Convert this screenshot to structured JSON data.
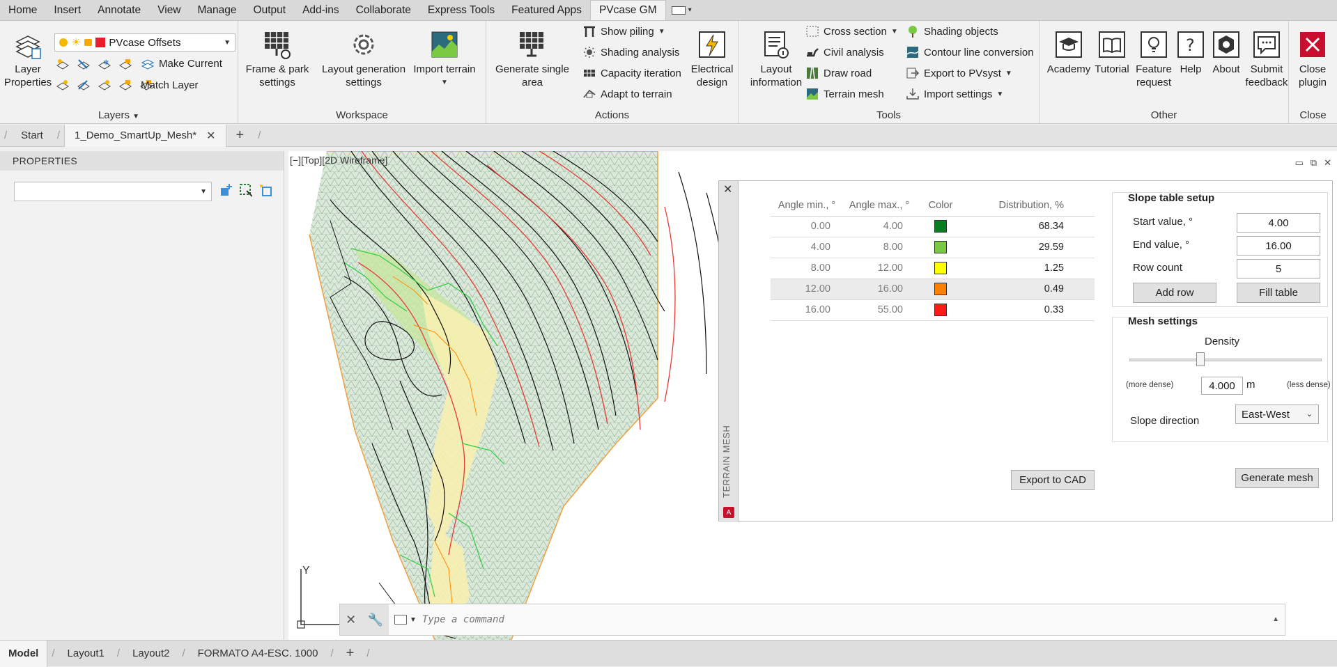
{
  "ribbon_tabs": [
    "Home",
    "Insert",
    "Annotate",
    "View",
    "Manage",
    "Output",
    "Add-ins",
    "Collaborate",
    "Express Tools",
    "Featured Apps",
    "PVcase GM"
  ],
  "active_tab": "PVcase GM",
  "layers_panel": {
    "layer_properties_l1": "Layer",
    "layer_properties_l2": "Properties",
    "layer_dropdown": "PVcase Offsets",
    "make_current": "Make Current",
    "match_layer": "Match Layer",
    "label": "Layers"
  },
  "workspace_panel": {
    "frame_park_l1": "Frame & park",
    "frame_park_l2": "settings",
    "layout_gen_l1": "Layout generation",
    "layout_gen_l2": "settings",
    "import_terrain": "Import terrain",
    "label": "Workspace"
  },
  "actions_panel": {
    "generate_l1": "Generate single",
    "generate_l2": "area",
    "show_piling": "Show piling",
    "shading_analysis": "Shading analysis",
    "capacity_iteration": "Capacity iteration",
    "adapt_to_terrain": "Adapt to terrain",
    "electrical_l1": "Electrical",
    "electrical_l2": "design",
    "label": "Actions"
  },
  "tools_panel": {
    "layout_info_l1": "Layout",
    "layout_info_l2": "information",
    "cross_section": "Cross section",
    "civil_analysis": "Civil analysis",
    "draw_road": "Draw road",
    "terrain_mesh": "Terrain mesh",
    "shading_objects": "Shading objects",
    "contour_line_conversion": "Contour line conversion",
    "export_pvsyst": "Export to PVsyst",
    "import_settings": "Import settings",
    "label": "Tools"
  },
  "other_panel": {
    "academy": "Academy",
    "tutorial": "Tutorial",
    "feature_l1": "Feature",
    "feature_l2": "request",
    "help": "Help",
    "about": "About",
    "submit_l1": "Submit",
    "submit_l2": "feedback",
    "label": "Other"
  },
  "close_panel": {
    "close_l1": "Close",
    "close_l2": "plugin",
    "label": "Close"
  },
  "doc_tabs": {
    "start": "Start",
    "active": "1_Demo_SmartUp_Mesh*"
  },
  "properties": {
    "title": "PROPERTIES"
  },
  "viewport_label": "[−][Top][2D Wireframe]",
  "terrain_mesh": {
    "side_label": "TERRAIN MESH",
    "table": {
      "headers": [
        "Angle min., °",
        "Angle max., °",
        "Color",
        "Distribution, %"
      ],
      "rows": [
        {
          "min": "0.00",
          "max": "4.00",
          "color": "#0a7d1e",
          "dist": "68.34"
        },
        {
          "min": "4.00",
          "max": "8.00",
          "color": "#7ac943",
          "dist": "29.59"
        },
        {
          "min": "8.00",
          "max": "12.00",
          "color": "#ffff00",
          "dist": "1.25"
        },
        {
          "min": "12.00",
          "max": "16.00",
          "color": "#ff7f00",
          "dist": "0.49"
        },
        {
          "min": "16.00",
          "max": "55.00",
          "color": "#ff1a1a",
          "dist": "0.33"
        }
      ],
      "selected_row": 3
    },
    "export_to_cad": "Export to CAD",
    "slope_setup": {
      "title": "Slope table setup",
      "start_label": "Start value, °",
      "start_value": "4.00",
      "end_label": "End value, °",
      "end_value": "16.00",
      "rowcount_label": "Row count",
      "rowcount_value": "5",
      "add_row": "Add row",
      "fill_table": "Fill table"
    },
    "mesh_settings": {
      "title": "Mesh settings",
      "density_label": "Density",
      "density_level": 0.37,
      "more_dense": "(more dense)",
      "less_dense": "(less dense)",
      "density_value": "4.000",
      "density_unit": "m",
      "slope_direction_label": "Slope direction",
      "slope_direction_value": "East-West",
      "generate_mesh": "Generate mesh"
    }
  },
  "command_line": {
    "placeholder": "Type a command"
  },
  "axis_label": "Y",
  "layout_tabs": [
    "Model",
    "Layout1",
    "Layout2",
    "FORMATO A4-ESC. 1000"
  ]
}
